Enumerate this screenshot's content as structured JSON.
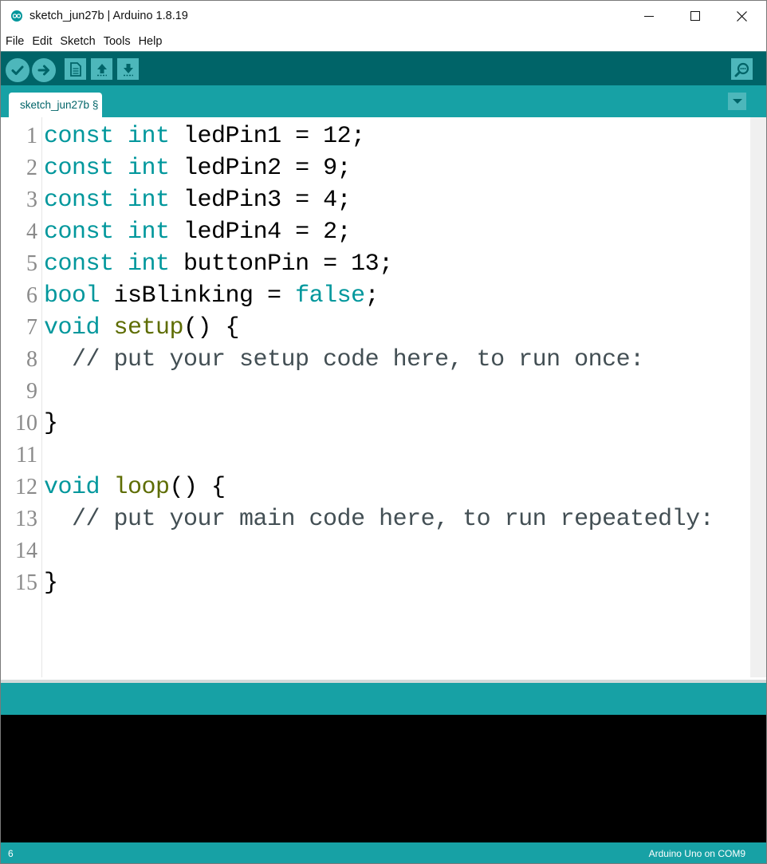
{
  "window": {
    "title": "sketch_jun27b | Arduino 1.8.19",
    "controls": [
      "minimize-icon",
      "maximize-icon",
      "close-icon"
    ]
  },
  "menu": {
    "items": [
      "File",
      "Edit",
      "Sketch",
      "Tools",
      "Help"
    ]
  },
  "toolbar": {
    "buttons": [
      "verify-icon",
      "upload-icon",
      "new-icon",
      "open-icon",
      "save-icon",
      "serial-monitor-icon"
    ]
  },
  "tabs": {
    "active": "sketch_jun27b §"
  },
  "editor": {
    "lines": [
      {
        "n": "1",
        "tokens": [
          [
            "kw",
            "const"
          ],
          [
            "t",
            " "
          ],
          [
            "kw",
            "int"
          ],
          [
            "t",
            " ledPin1 = 12;"
          ]
        ]
      },
      {
        "n": "2",
        "tokens": [
          [
            "kw",
            "const"
          ],
          [
            "t",
            " "
          ],
          [
            "kw",
            "int"
          ],
          [
            "t",
            " ledPin2 = 9;"
          ]
        ]
      },
      {
        "n": "3",
        "tokens": [
          [
            "kw",
            "const"
          ],
          [
            "t",
            " "
          ],
          [
            "kw",
            "int"
          ],
          [
            "t",
            " ledPin3 = 4;"
          ]
        ]
      },
      {
        "n": "4",
        "tokens": [
          [
            "kw",
            "const"
          ],
          [
            "t",
            " "
          ],
          [
            "kw",
            "int"
          ],
          [
            "t",
            " ledPin4 = 2;"
          ]
        ]
      },
      {
        "n": "5",
        "tokens": [
          [
            "kw",
            "const"
          ],
          [
            "t",
            " "
          ],
          [
            "kw",
            "int"
          ],
          [
            "t",
            " buttonPin = 13;"
          ]
        ]
      },
      {
        "n": "6",
        "tokens": [
          [
            "kw",
            "bool"
          ],
          [
            "t",
            " isBlinking = "
          ],
          [
            "kw",
            "false"
          ],
          [
            "t",
            ";"
          ]
        ]
      },
      {
        "n": "7",
        "tokens": [
          [
            "kw",
            "void"
          ],
          [
            "t",
            " "
          ],
          [
            "fn",
            "setup"
          ],
          [
            "t",
            "() {"
          ]
        ]
      },
      {
        "n": "8",
        "tokens": [
          [
            "cm",
            "  // put your setup code here, to run once:"
          ]
        ]
      },
      {
        "n": "9",
        "tokens": []
      },
      {
        "n": "10",
        "tokens": [
          [
            "t",
            "}"
          ]
        ]
      },
      {
        "n": "11",
        "tokens": []
      },
      {
        "n": "12",
        "tokens": [
          [
            "kw",
            "void"
          ],
          [
            "t",
            " "
          ],
          [
            "fn",
            "loop"
          ],
          [
            "t",
            "() {"
          ]
        ]
      },
      {
        "n": "13",
        "tokens": [
          [
            "cm",
            "  // put your main code here, to run repeatedly:"
          ]
        ]
      },
      {
        "n": "14",
        "tokens": []
      },
      {
        "n": "15",
        "tokens": [
          [
            "t",
            "}"
          ]
        ]
      }
    ]
  },
  "statusbar": {
    "line": "6",
    "board": "Arduino Uno on COM9"
  },
  "colors": {
    "toolbar": "#006468",
    "accent": "#17a1a5",
    "button": "#4db7bb",
    "keyword": "#00979c",
    "function": "#5e6d03",
    "comment": "#434f54"
  }
}
